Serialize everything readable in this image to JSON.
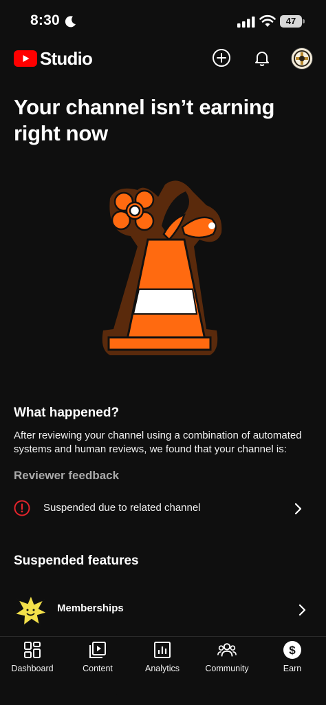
{
  "status_bar": {
    "time": "8:30",
    "battery": "47"
  },
  "header": {
    "app_name": "Studio",
    "brand_color": "#ff0000",
    "icons": [
      "create-icon",
      "bell-icon",
      "avatar"
    ]
  },
  "main": {
    "title": "Your channel isn’t earning right now",
    "what_happened": {
      "title": "What happened?",
      "description": "After reviewing your channel using a combination of automated systems and human reviews, we found that your channel is:"
    },
    "reviewer_feedback": {
      "title": "Reviewer feedback",
      "items": [
        {
          "label": "Suspended due to related channel",
          "icon": "alert-circle-icon",
          "icon_color": "#e3242b"
        }
      ]
    },
    "suspended_features": {
      "title": "Suspended features",
      "items": [
        {
          "label": "Memberships",
          "icon": "star-badge-icon",
          "icon_color": "#f3e04a"
        }
      ]
    }
  },
  "bottom_nav": {
    "items": [
      {
        "label": "Dashboard",
        "icon": "dashboard-icon"
      },
      {
        "label": "Content",
        "icon": "content-icon"
      },
      {
        "label": "Analytics",
        "icon": "analytics-icon"
      },
      {
        "label": "Community",
        "icon": "community-icon"
      },
      {
        "label": "Earn",
        "icon": "earn-icon",
        "active": true
      }
    ]
  }
}
